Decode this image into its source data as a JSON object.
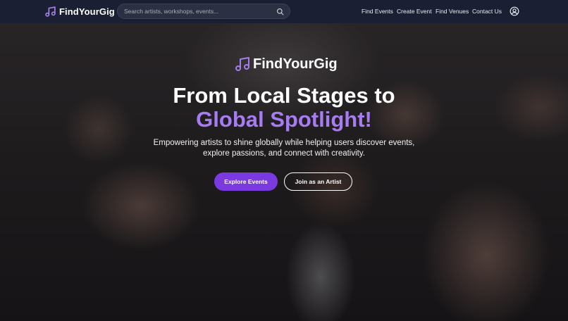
{
  "brand": {
    "name": "FindYourGig",
    "logo_icon": "music-note-icon",
    "accent": "#a67cf0"
  },
  "search": {
    "placeholder": "Search artists, workshops, events...",
    "icon": "search-icon"
  },
  "nav": {
    "links": [
      "Find Events",
      "Create Event",
      "Find Venues",
      "Contact Us"
    ],
    "user_icon": "user-circle-icon"
  },
  "hero": {
    "brand_name": "FindYourGig",
    "headline_line1": "From Local Stages to",
    "headline_line2": "Global Spotlight!",
    "subtext_line1": "Empowering artists to shine globally while helping users discover events,",
    "subtext_line2": "explore passions, and connect with creativity.",
    "primary_button": "Explore Events",
    "secondary_button": "Join as an Artist",
    "primary_color": "#7b39e0"
  }
}
